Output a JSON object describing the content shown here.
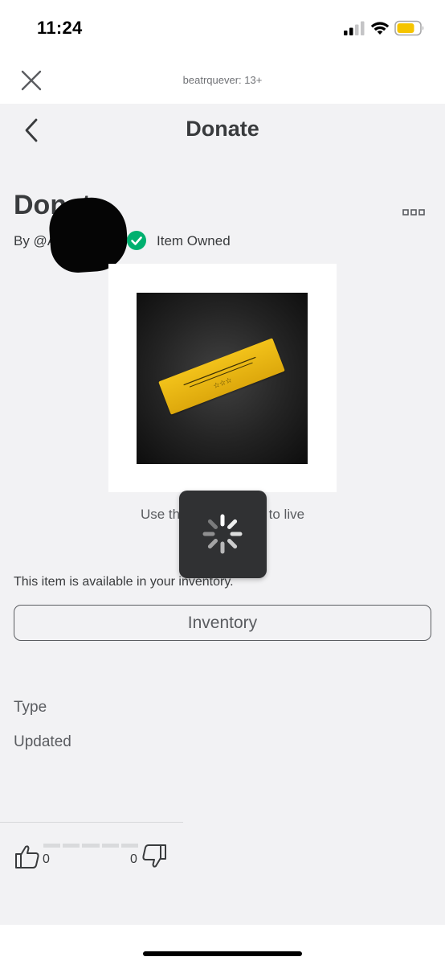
{
  "status_bar": {
    "time": "11:24",
    "icons": [
      "cellular-signal-icon",
      "wifi-icon",
      "battery-icon"
    ],
    "battery_color": "#f5c400"
  },
  "modal_header": {
    "caption": "beatrquever: 13+",
    "close_icon": "close-icon"
  },
  "page_header": {
    "title": "Donate",
    "back_icon": "chevron-left-icon"
  },
  "item": {
    "name": "Donate",
    "creator_prefix": "By @A",
    "owned_label": "Item Owned",
    "owned_color": "#00b06f",
    "more_icon": "more-horizontal-icon",
    "thumbnail": "gold-ticket-pass-image",
    "use_pass_text": "Use this Pass in: tap to live",
    "available_text": "This item is available in your inventory.",
    "inventory_button": "Inventory"
  },
  "details": {
    "type_label": "Type",
    "updated_label": "Updated"
  },
  "votes": {
    "up_count": "0",
    "down_count": "0",
    "up_icon": "thumbs-up-icon",
    "down_icon": "thumbs-down-icon"
  },
  "loading": {
    "icon": "loading-spinner-icon"
  },
  "colors": {
    "background": "#f2f2f4",
    "text": "#393b3d",
    "ticket_gold": "#f2c21a"
  }
}
